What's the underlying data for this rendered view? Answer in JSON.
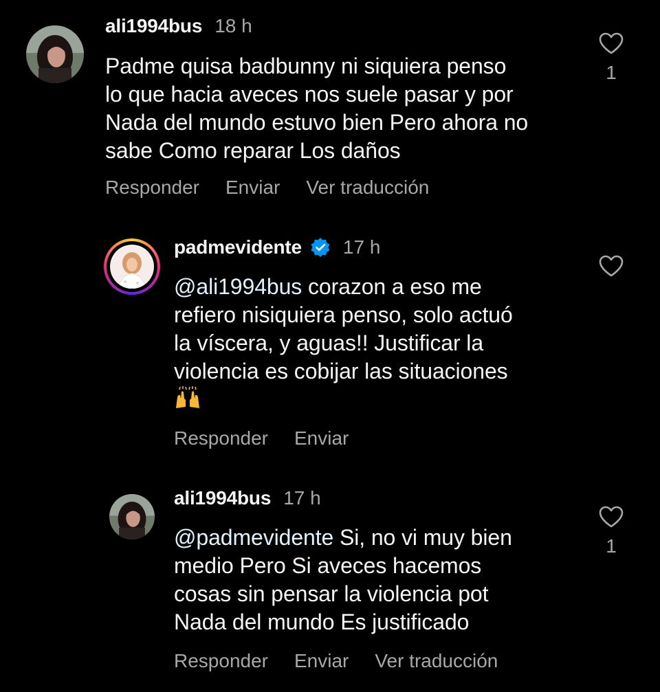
{
  "comments": [
    {
      "username": "ali1994bus",
      "time": "18 h",
      "text": "Padme quisa badbunny ni siquiera penso\nlo que hacia aveces nos suele pasar y por\nNada del mundo estuvo bien Pero ahora no\nsabe Como reparar Los daños",
      "likes": "1",
      "actions": {
        "reply": "Responder",
        "send": "Enviar",
        "translate": "Ver traducción"
      }
    },
    {
      "username": "padmevidente",
      "verified": true,
      "time": "17 h",
      "mention": "@ali1994bus",
      "text": " corazon a eso me\nrefiero nisiquiera penso, solo actuó\nla víscera, y aguas!! Justificar la\nviolencia es cobijar las situaciones",
      "emoji": "raising-hands-emoji",
      "actions": {
        "reply": "Responder",
        "send": "Enviar"
      }
    },
    {
      "username": "ali1994bus",
      "time": "17 h",
      "mention": "@padmevidente",
      "text": " Si, no vi muy bien\nmedio Pero Si aveces hacemos\ncosas sin pensar la violencia pot\nNada del mundo Es justificado",
      "likes": "1",
      "actions": {
        "reply": "Responder",
        "send": "Enviar",
        "translate": "Ver traducción"
      }
    }
  ],
  "colors": {
    "background": "#000000",
    "primary_text": "#f5f5f5",
    "secondary_text": "#a8a8a8",
    "mention": "#e0f1ff",
    "verified_badge": "#0095f6"
  }
}
